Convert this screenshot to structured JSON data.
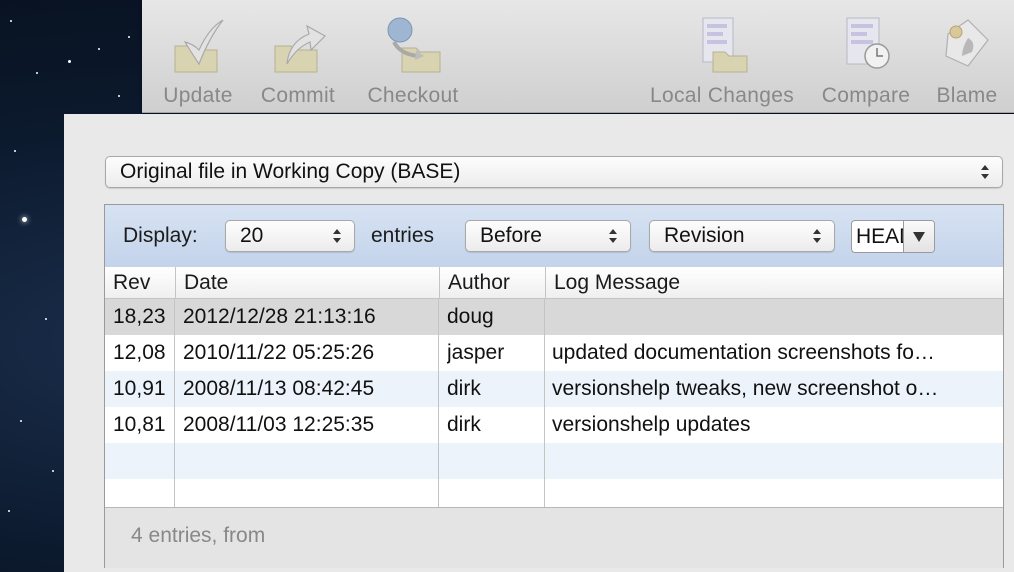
{
  "toolbar": {
    "update_label": "Update",
    "commit_label": "Commit",
    "checkout_label": "Checkout",
    "local_changes_label": "Local Changes",
    "compare_label": "Compare",
    "blame_label": "Blame"
  },
  "file_selector": {
    "selected": "Original file in Working Copy (BASE)"
  },
  "filter": {
    "display_label": "Display:",
    "count_selected": "20",
    "entries_label": "entries",
    "relation_selected": "Before",
    "kind_selected": "Revision",
    "revision_value": "HEAD"
  },
  "table": {
    "headers": {
      "rev": "Rev",
      "date": "Date",
      "author": "Author",
      "message": "Log Message"
    },
    "rows": [
      {
        "rev": "18,23",
        "date": "2012/12/28 21:13:16",
        "author": "doug",
        "message": ""
      },
      {
        "rev": "12,08",
        "date": "2010/11/22 05:25:26",
        "author": "jasper",
        "message": "updated documentation screenshots fo…"
      },
      {
        "rev": "10,91",
        "date": "2008/11/13 08:42:45",
        "author": "dirk",
        "message": "versionshelp tweaks, new screenshot o…"
      },
      {
        "rev": "10,81",
        "date": "2008/11/03 12:25:35",
        "author": "dirk",
        "message": "versionshelp updates"
      }
    ]
  },
  "footer": {
    "status": "4 entries, from"
  },
  "colors": {
    "filter_bar": "#c8d7ec",
    "selected_row": "#d8d8d8",
    "alt_row": "#edf3fb"
  }
}
